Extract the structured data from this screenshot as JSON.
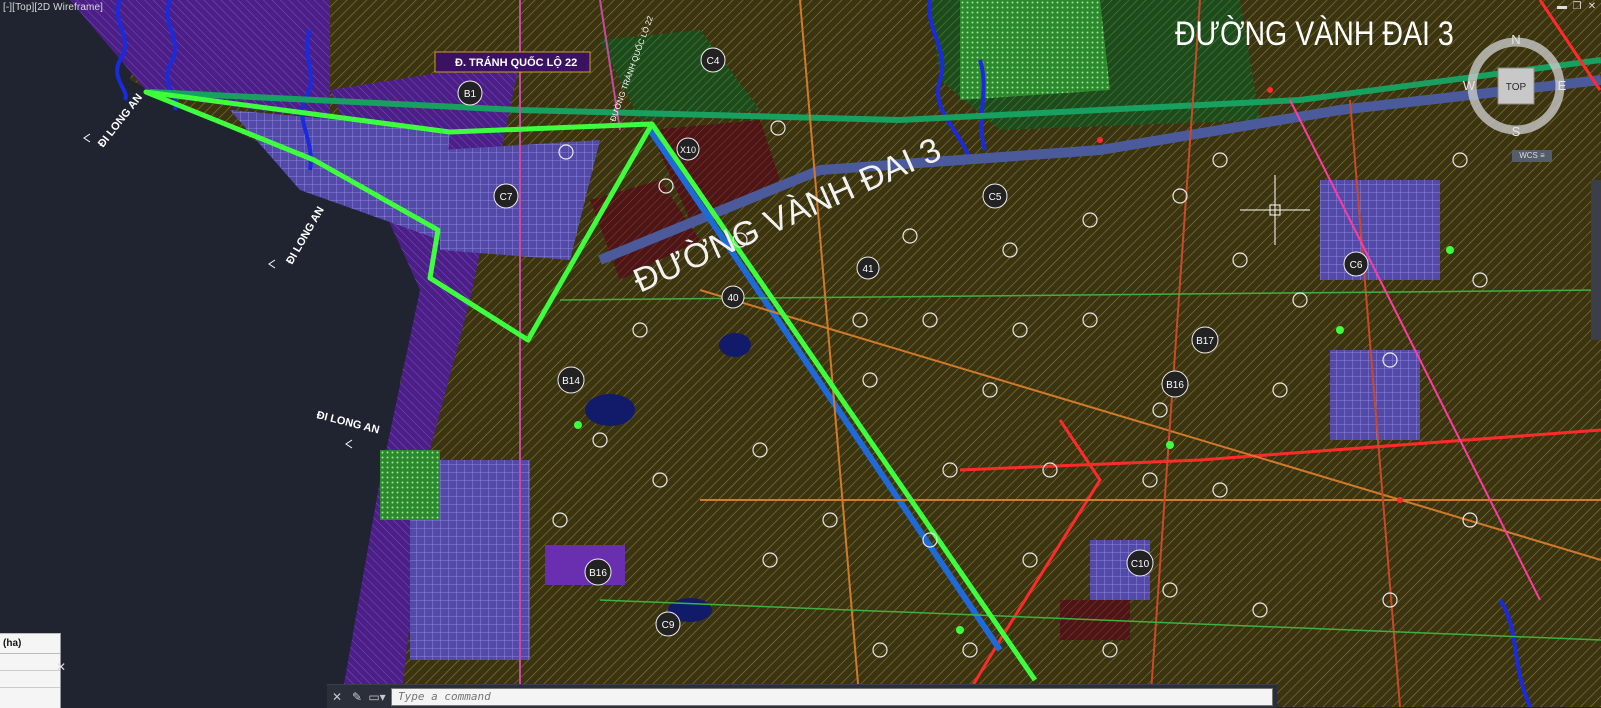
{
  "viewport": {
    "label": "[-][Top][2D Wireframe]"
  },
  "window_controls": {
    "minimize": "▬",
    "restore": "❐",
    "close": "✕"
  },
  "map_labels": {
    "ring_road_title": "ĐƯỜNG VÀNH ĐAI 3",
    "ring_road_diag": "ĐƯỜNG VÀNH ĐAI 3",
    "bypass_ql22": "Đ. TRÁNH QUỐC LỘ 22",
    "bypass_vertical": "ĐƯỜNG TRÁNH QUỐC LỘ 22",
    "di_long_an_1": "ĐI LONG AN",
    "di_long_an_2": "ĐI LONG AN",
    "di_long_an_3": "ĐI LONG AN"
  },
  "zones": [
    "B1",
    "C4",
    "C7",
    "C5",
    "B14",
    "B16",
    "B17",
    "B16",
    "C6",
    "C10",
    "C9",
    "40",
    "41",
    "X10"
  ],
  "compass": {
    "n": "N",
    "s": "S",
    "e": "E",
    "w": "W",
    "face": "TOP",
    "wcs": "WCS ≡"
  },
  "command_line": {
    "placeholder": "Type a command",
    "close": "✕",
    "customize": "✎",
    "recent": "▭▾"
  },
  "side_table": {
    "header": "(ha)",
    "close": "✕"
  },
  "colors": {
    "background": "#1f2430",
    "highlight": "#3dff3d",
    "road_red": "#ff2a2a",
    "zone_purple": "#5a1f90",
    "zone_brown": "#4a3a12",
    "zone_lavender": "#6b5fc4",
    "water": "#1a2bdc"
  }
}
